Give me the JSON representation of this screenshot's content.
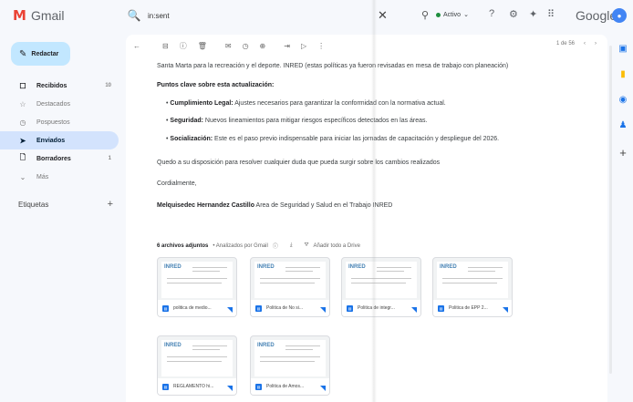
{
  "header": {
    "app_name": "Gmail",
    "search_query": "in:sent",
    "status_label": "Activo",
    "brand": "Google",
    "icons": [
      "search-icon",
      "close-icon",
      "filter-icon",
      "help-icon",
      "settings-icon",
      "gemini-icon",
      "apps-grid-icon"
    ]
  },
  "compose": {
    "label": "Redactar"
  },
  "sidebar": {
    "items": [
      {
        "label": "Recibidos",
        "icon": "inbox-icon",
        "count": "10",
        "glyph": "☐",
        "state": "bold"
      },
      {
        "label": "Destacados",
        "icon": "star-icon",
        "count": "",
        "glyph": "☆",
        "state": ""
      },
      {
        "label": "Pospuestos",
        "icon": "clock-icon",
        "count": "",
        "glyph": "◷",
        "state": ""
      },
      {
        "label": "Enviados",
        "icon": "send-icon",
        "count": "",
        "glyph": "➤",
        "state": "active"
      },
      {
        "label": "Borradores",
        "icon": "draft-icon",
        "count": "1",
        "glyph": "🗋",
        "state": "bold"
      },
      {
        "label": "Más",
        "icon": "chevron-down-icon",
        "count": "",
        "glyph": "⌄",
        "state": ""
      }
    ],
    "labels_heading": "Etiquetas",
    "labels_add": "+"
  },
  "toolbar": {
    "pager": "1 de 56",
    "icons": [
      "back-icon",
      "archive-icon",
      "report-icon",
      "delete-icon",
      "mark-unread-icon",
      "snooze-icon",
      "task-icon",
      "move-icon",
      "label-icon",
      "more-icon"
    ]
  },
  "email": {
    "intro": "Santa Marta para la recreación y el deporte. INRED (estas políticas ya fueron revisadas en mesa de trabajo con planeación)",
    "key_points_title": "Puntos clave sobre esta actualización:",
    "bullets": [
      {
        "term": "Cumplimiento Legal:",
        "text": " Ajustes necesarios para garantizar la conformidad con la normativa actual."
      },
      {
        "term": "Seguridad:",
        "text": " Nuevos lineamientos para mitigar riesgos específicos detectados en las áreas."
      },
      {
        "term": "Socialización:",
        "text": " Este es el paso previo indispensable para iniciar las jornadas de capacitación y despliegue del 2026."
      }
    ],
    "closing": "Quedo a su disposición para resolver cualquier duda que pueda surgir sobre los cambios realizados",
    "regards": "Cordialmente,",
    "signature_name": "Melquisedec Hernandez Castillo",
    "signature_role": " Area de Seguridad y Salud en el Trabajo INRED"
  },
  "attachments": {
    "count_label": "6 archivos adjuntos",
    "scanned_label": "• Analizados por Gmail",
    "add_drive_label": "Añadir todo a Drive",
    "logo_text": "INRED",
    "files": [
      "politica de medio...",
      "Politica de No si...",
      "Politica de integr...",
      "Politica de EPP 2...",
      "REGLAMENTO hi...",
      "Politica de Amos..."
    ]
  },
  "side_panel": {
    "icons": [
      "calendar-icon",
      "keep-icon",
      "tasks-icon",
      "contacts-icon",
      "add-icon"
    ]
  }
}
